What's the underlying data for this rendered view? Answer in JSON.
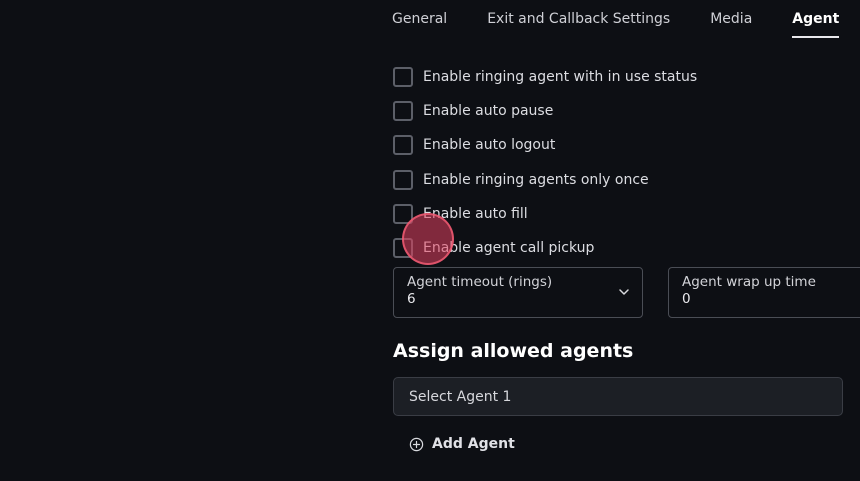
{
  "tabs": [
    {
      "label": "General"
    },
    {
      "label": "Exit and Callback Settings"
    },
    {
      "label": "Media"
    },
    {
      "label": "Agent"
    }
  ],
  "options": [
    {
      "label": "Enable ringing agent with in use status",
      "checked": false
    },
    {
      "label": "Enable auto pause",
      "checked": false
    },
    {
      "label": "Enable auto logout",
      "checked": false
    },
    {
      "label": "Enable ringing agents only once",
      "checked": false
    },
    {
      "label": "Enable auto fill",
      "checked": false
    },
    {
      "label": "Enable agent call pickup",
      "checked": false
    }
  ],
  "agent_timeout": {
    "label": "Agent timeout (rings)",
    "value": "6"
  },
  "agent_wrap_up": {
    "label": "Agent wrap up time",
    "value": "0"
  },
  "assign": {
    "title": "Assign allowed agents",
    "select_label": "Select Agent 1",
    "add_label": "Add Agent"
  },
  "colors": {
    "background": "#0d0f14",
    "click_indicator": "#e2405e",
    "field_border": "#4a4d55"
  }
}
